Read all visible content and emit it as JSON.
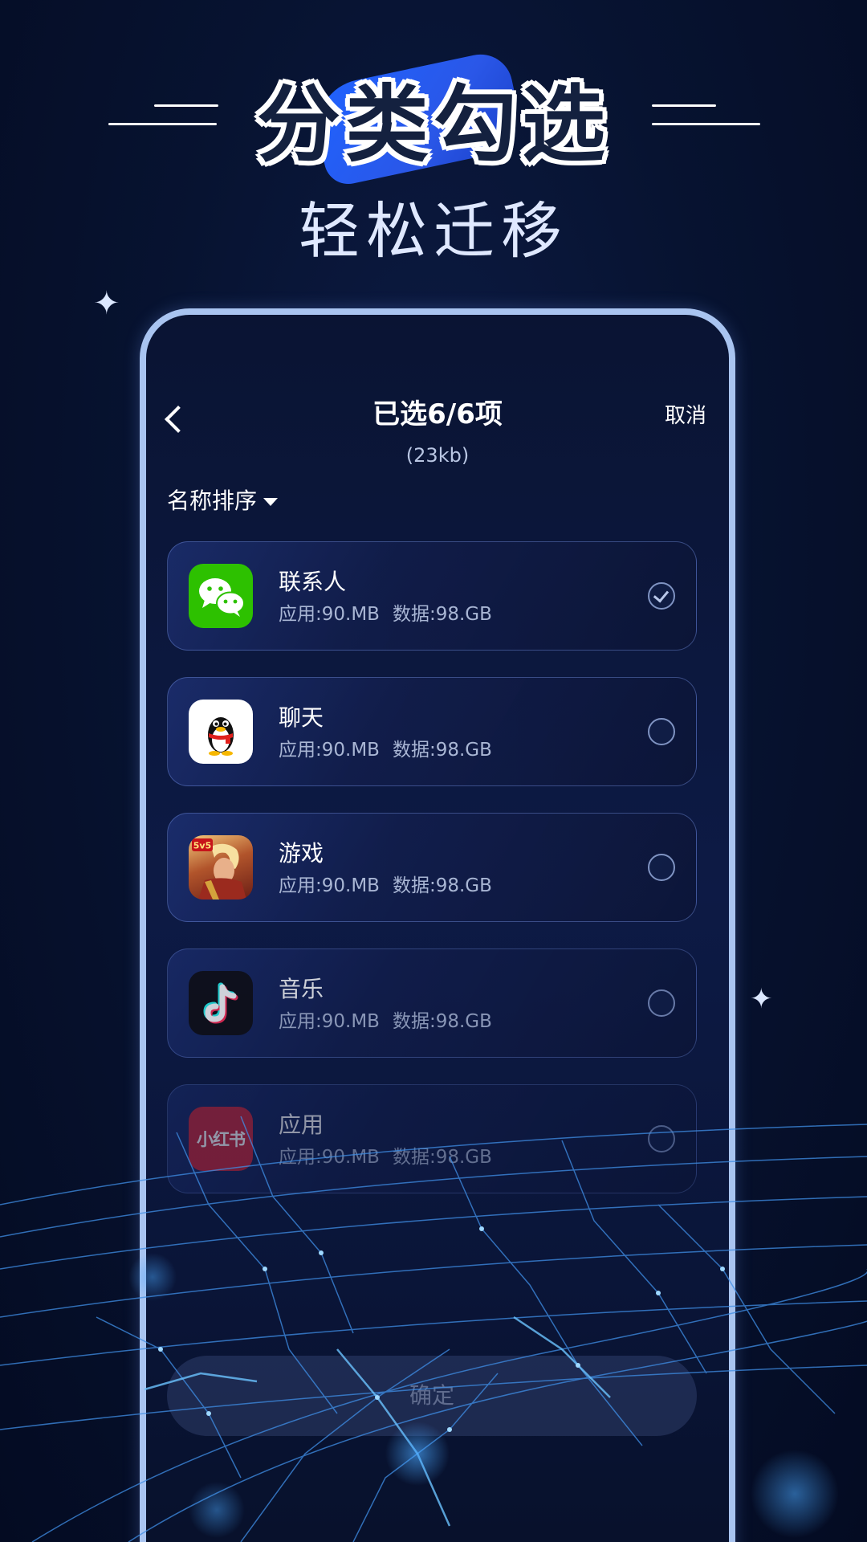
{
  "hero": {
    "title": "分类勾选",
    "subtitle": "轻松迁移"
  },
  "screen": {
    "title": "已选6/6项",
    "size": "(23kb)",
    "cancel_label": "取消",
    "sort_label": "名称排序",
    "confirm_label": "确定"
  },
  "apps": [
    {
      "name": "联系人",
      "app_size": "应用:90.MB",
      "data_size": "数据:98.GB",
      "icon": "wechat-icon",
      "checked": true
    },
    {
      "name": "聊天",
      "app_size": "应用:90.MB",
      "data_size": "数据:98.GB",
      "icon": "qq-penguin-icon",
      "checked": false
    },
    {
      "name": "游戏",
      "app_size": "应用:90.MB",
      "data_size": "数据:98.GB",
      "icon": "game-hero-icon",
      "icon_badge": "5v5",
      "checked": false
    },
    {
      "name": "音乐",
      "app_size": "应用:90.MB",
      "data_size": "数据:98.GB",
      "icon": "tiktok-icon",
      "checked": false
    },
    {
      "name": "应用",
      "app_size": "应用:90.MB",
      "data_size": "数据:98.GB",
      "icon": "xiaohongshu-icon",
      "icon_text": "小红书",
      "checked": false
    }
  ],
  "colors": {
    "background": "#050d24",
    "frame": "#a9c4f0",
    "accent_blue": "#1f63ff",
    "wechat_green": "#2dc100",
    "xiaohongshu_red": "#c9263a"
  }
}
